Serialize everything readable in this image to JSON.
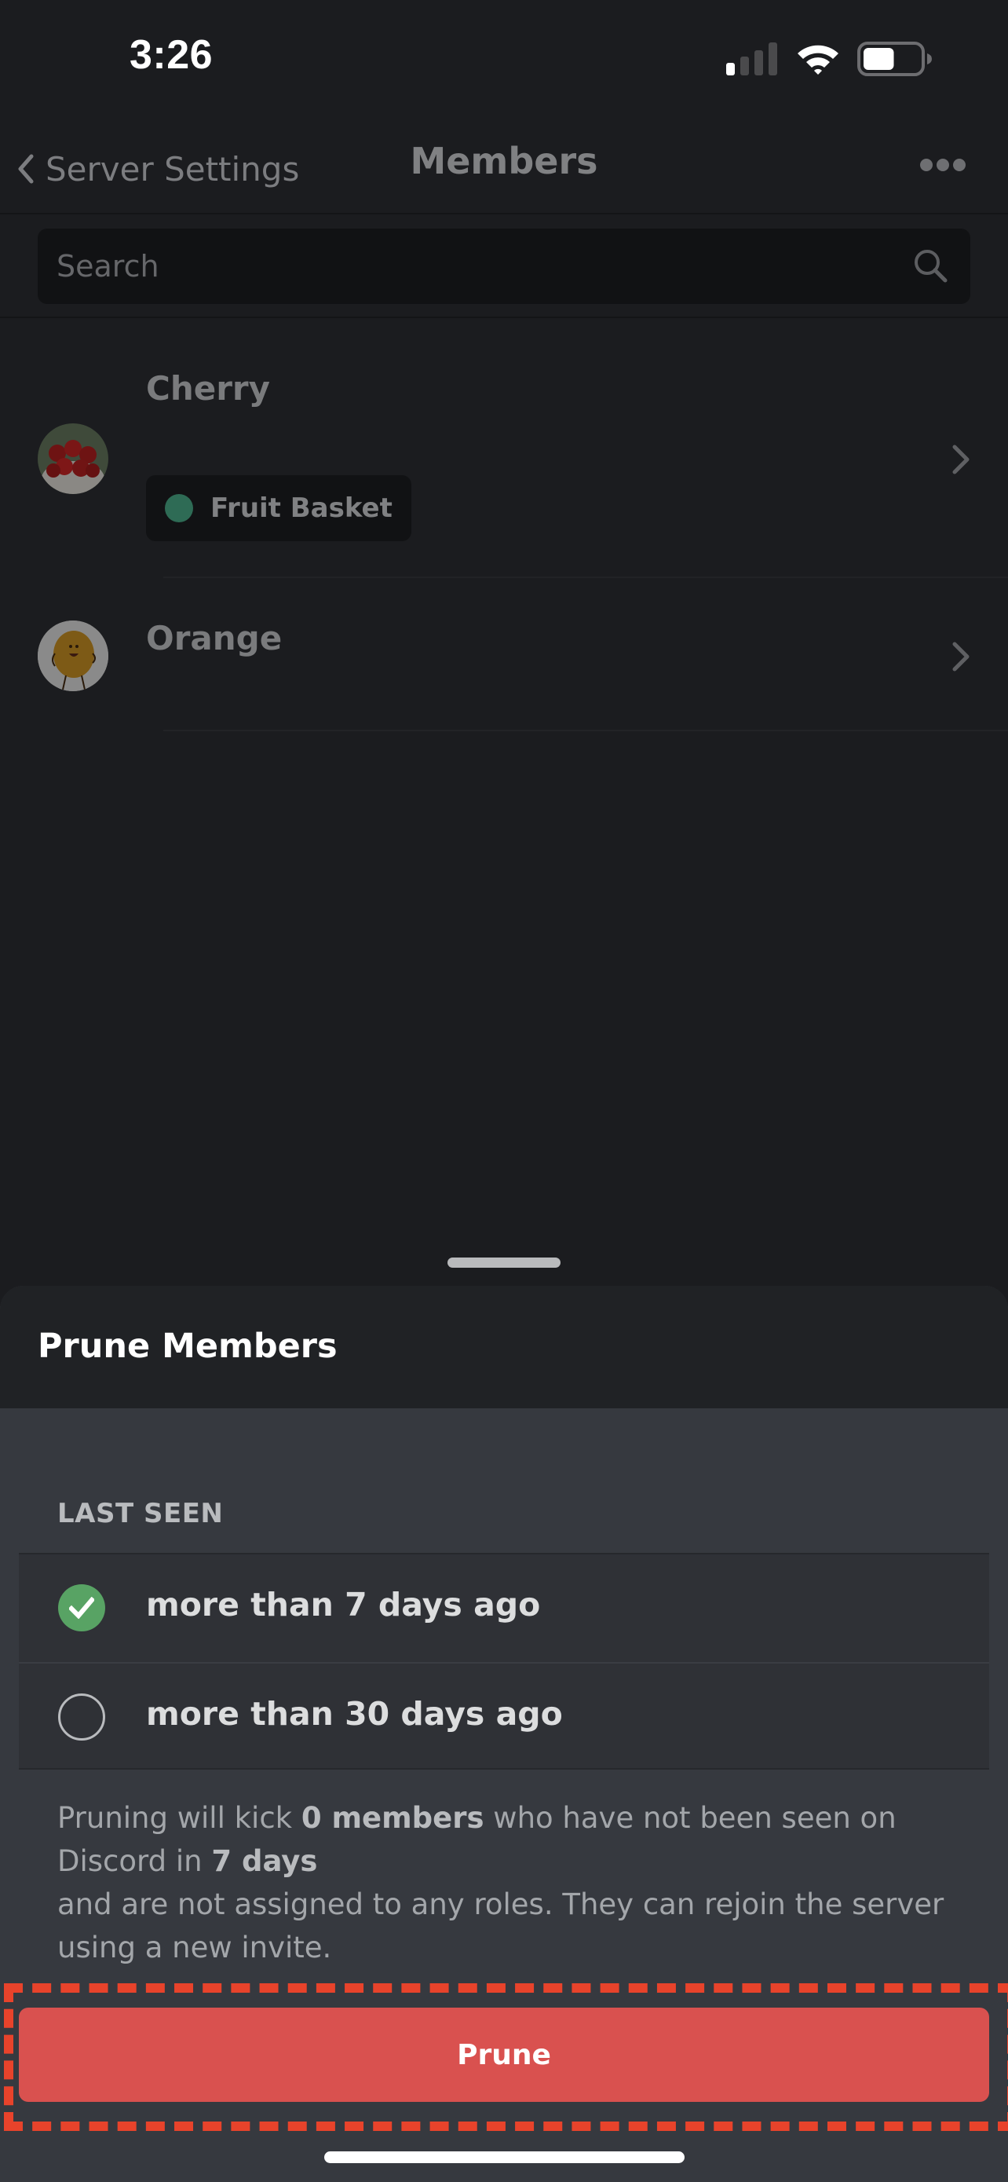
{
  "status_bar": {
    "time": "3:26",
    "signal_bars_active": 1,
    "signal_bars_total": 4,
    "battery_level": 0.55
  },
  "nav": {
    "back_label": "Server Settings",
    "title": "Members",
    "back_icon": "chevron-left-icon",
    "more_icon": "more-horizontal-icon"
  },
  "search": {
    "placeholder": "Search",
    "value": "",
    "icon": "search-icon"
  },
  "members": [
    {
      "name": "Cherry",
      "avatar": "cherry-avatar",
      "roles": [
        {
          "name": "Fruit Basket",
          "color": "#2e6b55"
        }
      ]
    },
    {
      "name": "Orange",
      "avatar": "orange-avatar",
      "roles": []
    }
  ],
  "prune_sheet": {
    "title": "Prune Members",
    "section_label": "LAST SEEN",
    "options": [
      {
        "label": "more than 7 days ago",
        "selected": true
      },
      {
        "label": "more than 30 days ago",
        "selected": false
      }
    ],
    "description": {
      "part1": "Pruning will kick ",
      "count_bold": "0 members",
      "part2": " who have not been seen on Discord in ",
      "days_bold": "7 days",
      "part3": "and are not assigned to any roles. They can rejoin the server using a new invite."
    },
    "prune_button_label": "Prune",
    "accent_color": "#d9514f",
    "check_color": "#58a364"
  }
}
